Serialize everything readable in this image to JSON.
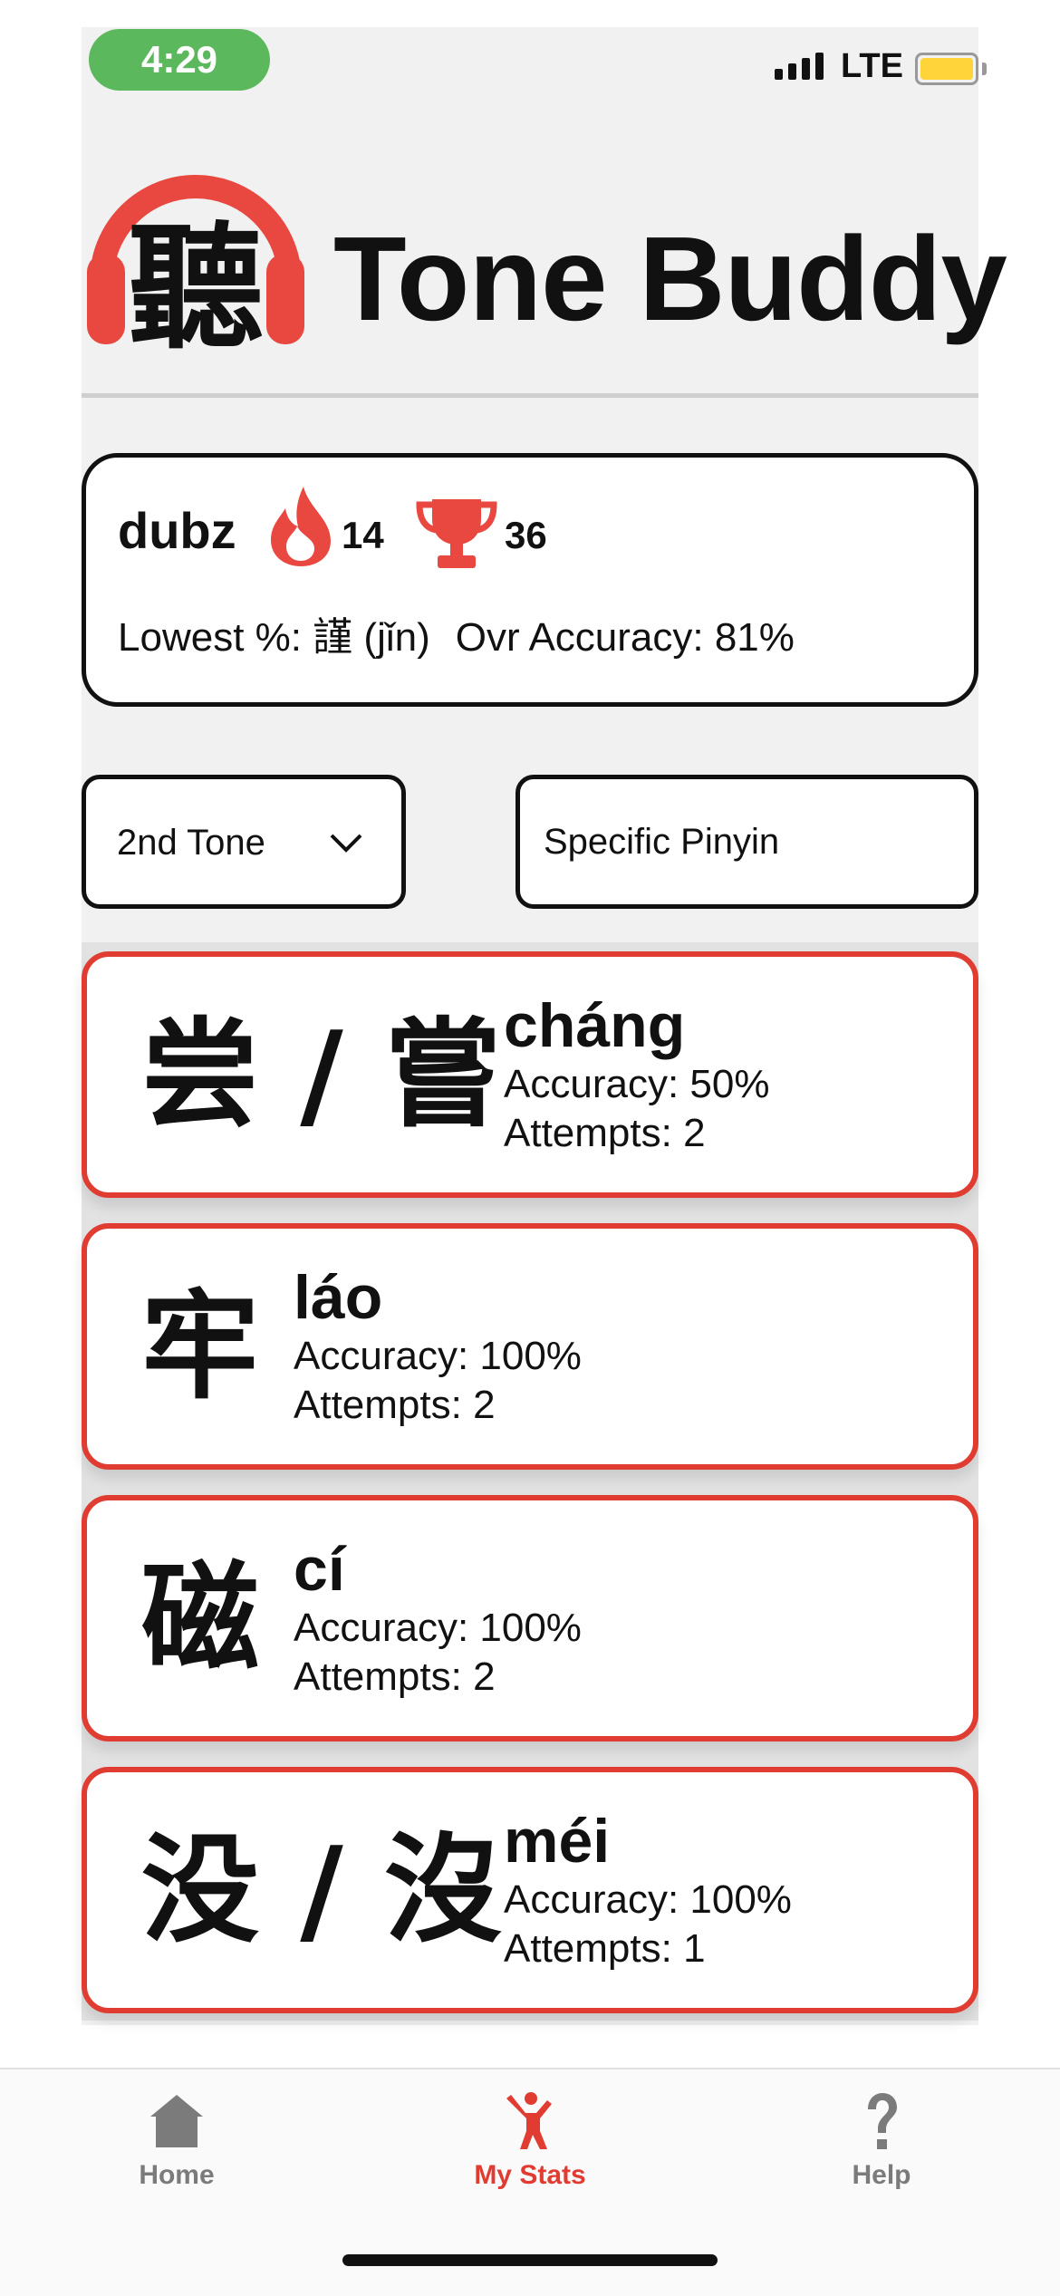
{
  "status_bar": {
    "time": "4:29",
    "network": "LTE"
  },
  "header": {
    "logo_glyph": "聽",
    "title": "Tone Buddy"
  },
  "profile": {
    "username": "dubz",
    "streak": "14",
    "trophies": "36",
    "lowest": "Lowest %: 謹 (jǐn)",
    "overall": "Ovr Accuracy: 81%"
  },
  "filters": {
    "tone_selected": "2nd Tone",
    "pinyin_placeholder": "Specific Pinyin"
  },
  "characters": [
    {
      "glyph": "尝 / 嘗",
      "pinyin": "cháng",
      "accuracy": "Accuracy: 50%",
      "attempts": "Attempts: 2"
    },
    {
      "glyph": "牢",
      "pinyin": "láo",
      "accuracy": "Accuracy: 100%",
      "attempts": "Attempts: 2"
    },
    {
      "glyph": "磁",
      "pinyin": "cí",
      "accuracy": "Accuracy: 100%",
      "attempts": "Attempts: 2"
    },
    {
      "glyph": "没 / 沒",
      "pinyin": "méi",
      "accuracy": "Accuracy: 100%",
      "attempts": "Attempts: 1"
    }
  ],
  "tabs": [
    {
      "label": "Home",
      "icon": "house-icon",
      "active": false
    },
    {
      "label": "My Stats",
      "icon": "person-stats-icon",
      "active": true
    },
    {
      "label": "Help",
      "icon": "question-mark-icon",
      "active": false
    }
  ],
  "colors": {
    "accent": "#e03c31",
    "status_pill": "#5cb85c",
    "battery": "#ffd43b",
    "inactive_tab": "#7b7b7b"
  }
}
